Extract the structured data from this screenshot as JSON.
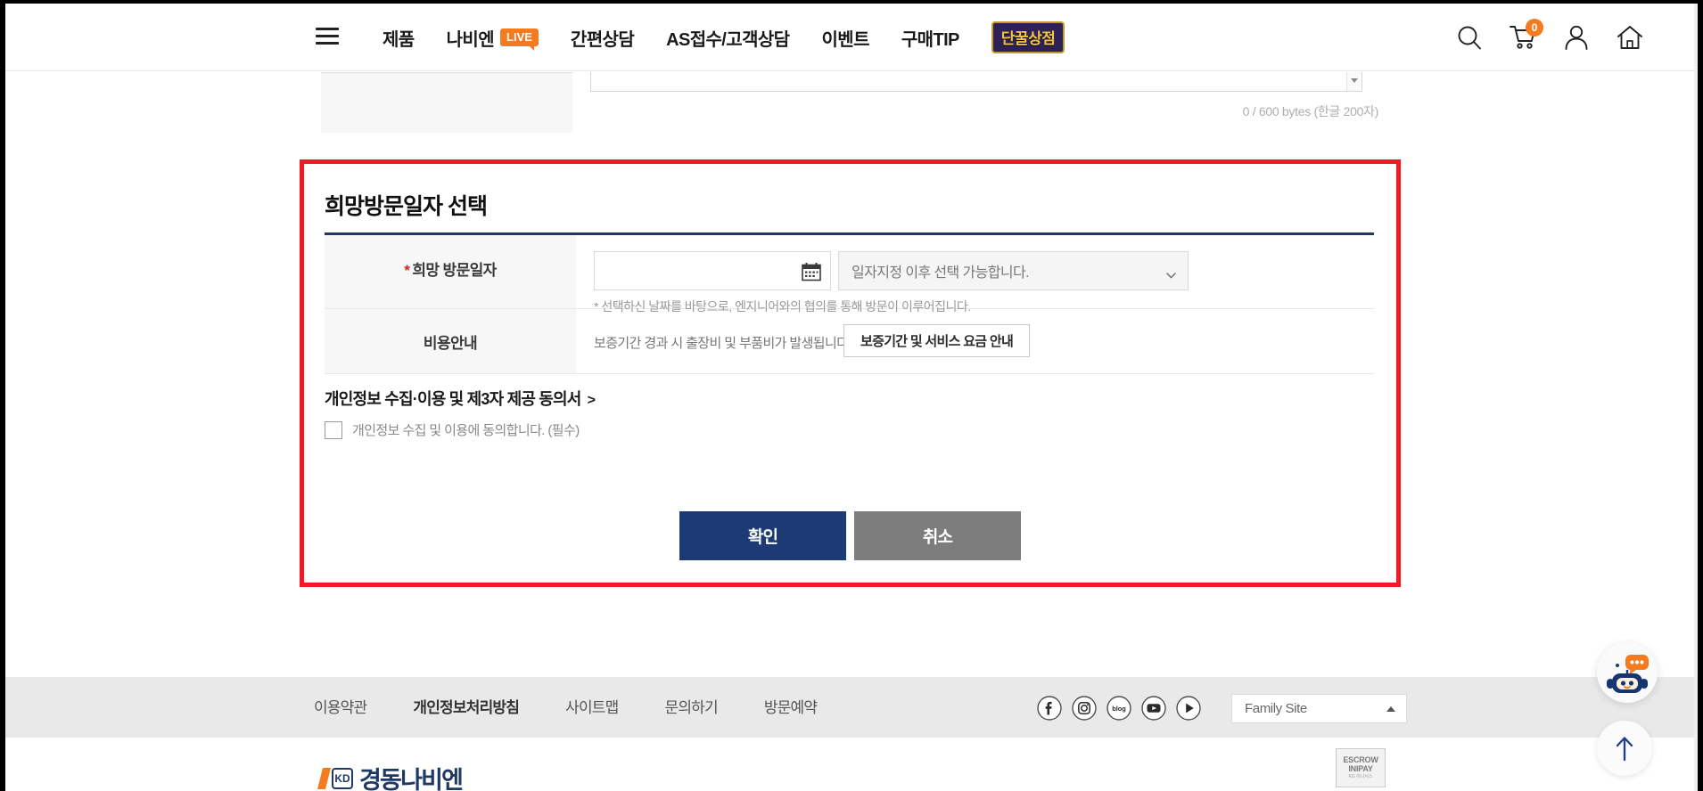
{
  "header": {
    "menu_icon": "hamburger-icon",
    "nav": [
      {
        "label": "제품",
        "badge": null
      },
      {
        "label": "나비엔",
        "badge": "LIVE"
      },
      {
        "label": "간편상담",
        "badge": null
      },
      {
        "label": "AS접수/고객상담",
        "badge": null
      },
      {
        "label": "이벤트",
        "badge": null
      },
      {
        "label": "구매TIP",
        "badge": null
      }
    ],
    "shop_badge": "단꿀상점",
    "icons": [
      {
        "name": "search-icon"
      },
      {
        "name": "cart-icon",
        "badge": "0"
      },
      {
        "name": "user-icon"
      },
      {
        "name": "home-icon"
      }
    ]
  },
  "top_block": {
    "byte_counter": "0 / 600 bytes (한글 200자)"
  },
  "visit_section": {
    "title": "희망방문일자 선택",
    "date_row": {
      "label": "희망 방문일자",
      "required_mark": "*",
      "date_value": "",
      "date_placeholder": "",
      "calendar_icon": "calendar-icon",
      "select_value": "일자지정 이후 선택 가능합니다.",
      "note": "* 선택하신 날짜를 바탕으로, 엔지니어와의 협의를 통해 방문이 이루어집니다."
    },
    "cost_row": {
      "label": "비용안내",
      "text": "보증기간 경과 시 출장비 및 부품비가 발생됩니다.",
      "button": "보증기간 및 서비스 요금 안내"
    },
    "agreement": {
      "link": "개인정보 수집·이용 및 제3자 제공 동의서",
      "link_chevron": ">",
      "checkbox_label": "개인정보 수집 및 이용에 동의합니다. (필수)",
      "checked": false
    },
    "buttons": {
      "confirm": "확인",
      "cancel": "취소"
    }
  },
  "footer": {
    "links": [
      {
        "label": "이용약관",
        "bold": false
      },
      {
        "label": "개인정보처리방침",
        "bold": true
      },
      {
        "label": "사이트맵",
        "bold": false
      },
      {
        "label": "문의하기",
        "bold": false
      },
      {
        "label": "방문예약",
        "bold": false
      }
    ],
    "socials": [
      {
        "name": "facebook-icon",
        "glyph": "f"
      },
      {
        "name": "instagram-icon",
        "glyph": ""
      },
      {
        "name": "blog-icon",
        "glyph": "blog"
      },
      {
        "name": "youtube-icon",
        "glyph": ""
      },
      {
        "name": "play-icon",
        "glyph": ""
      }
    ],
    "family_site": "Family Site",
    "logo_text": "경동나비엔",
    "logo_mark": "KD",
    "escrow_title": "ESCROW",
    "escrow_sub": "INIPAY",
    "escrow_small": "KG 이니시스"
  },
  "floating": {
    "chatbot": "chatbot-icon",
    "scroll_top": "scroll-to-top-icon"
  },
  "colors": {
    "accent_orange": "#f47b20",
    "navy": "#1f3864",
    "confirm_blue": "#1c3b75",
    "cancel_gray": "#7d7d7d",
    "highlight_red": "#ee1b24"
  }
}
